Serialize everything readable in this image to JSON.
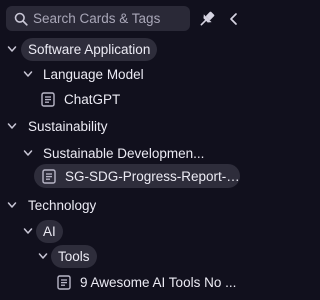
{
  "search": {
    "placeholder": "Search Cards & Tags"
  },
  "tree": {
    "software_application": "Software Application",
    "language_model": "Language Model",
    "chatgpt": "ChatGPT",
    "sustainability": "Sustainability",
    "sustainable_development": "Sustainable Developmen...",
    "sdg_report": "SG-SDG-Progress-Report-2...",
    "technology": "Technology",
    "ai": "AI",
    "tools": "Tools",
    "ai_tools_card": "9 Awesome AI Tools No ..."
  },
  "icons": {
    "search": "search-icon",
    "pin": "pin-icon",
    "collapse": "chevron-left-icon",
    "expand": "chevron-down-icon",
    "card": "document-icon"
  },
  "colors": {
    "background": "#11101d",
    "input": "#2a2937",
    "pill": "#2e2d3b",
    "text": "#ecebf4"
  }
}
